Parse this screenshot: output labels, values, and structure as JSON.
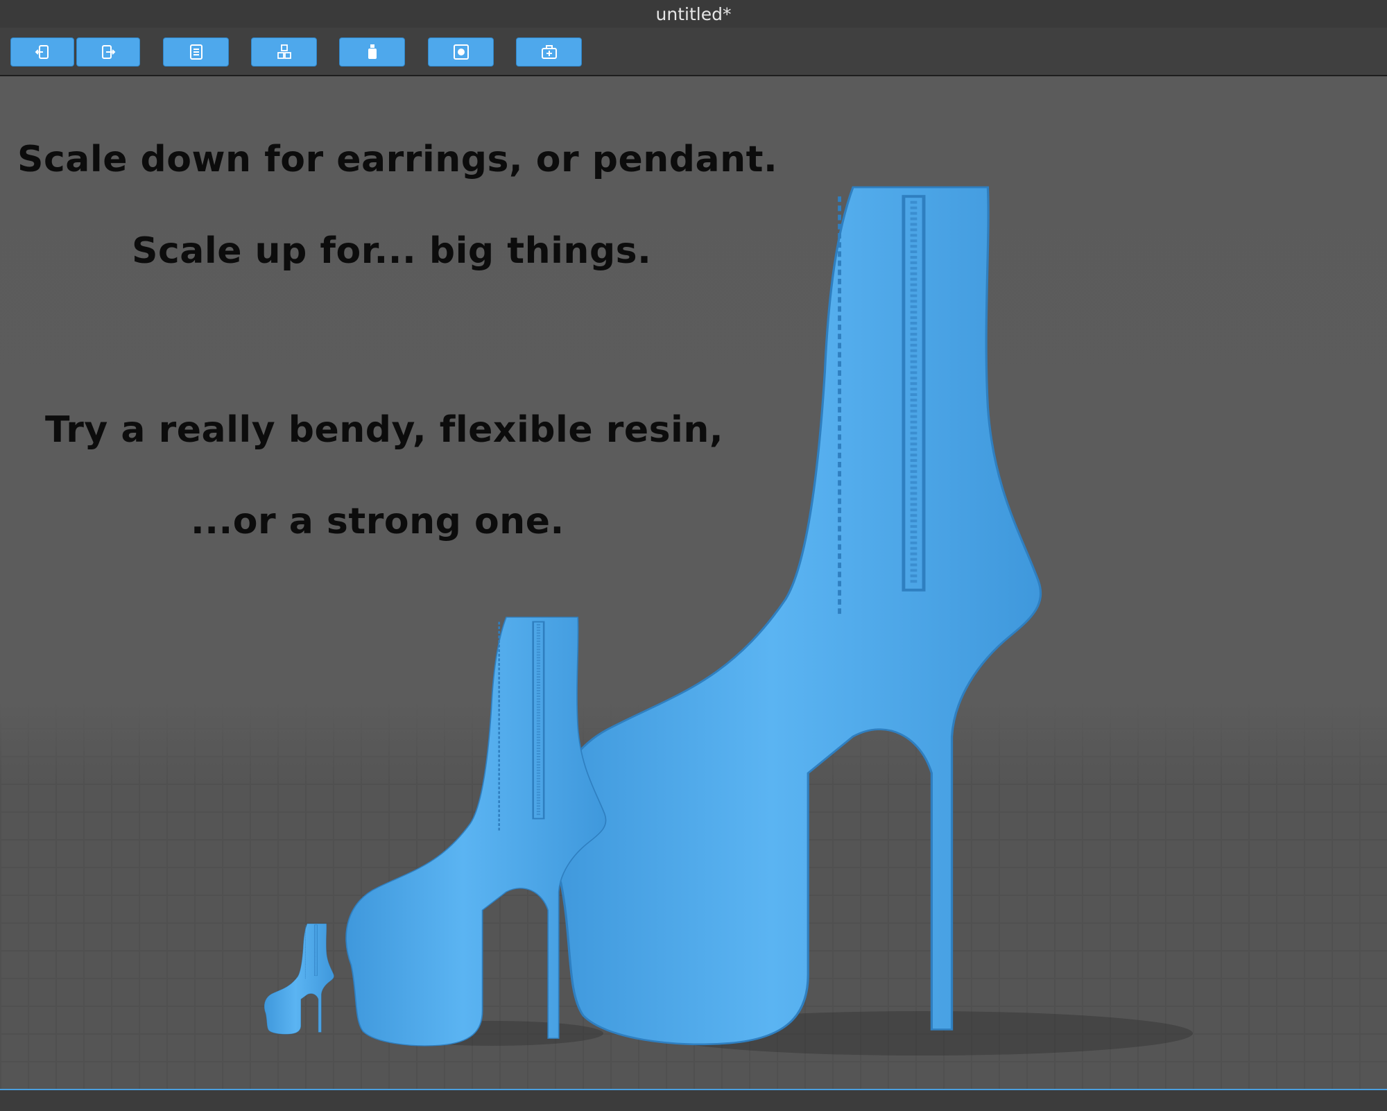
{
  "window": {
    "title": "untitled*"
  },
  "toolbar": {
    "buttons": [
      {
        "name": "import-icon"
      },
      {
        "name": "export-icon"
      },
      {
        "name": "list-icon"
      },
      {
        "name": "cubes-icon"
      },
      {
        "name": "bottle-icon"
      },
      {
        "name": "square-target-icon"
      },
      {
        "name": "add-support-icon"
      }
    ]
  },
  "viewport": {
    "lines": [
      "Scale down for earrings, or pendant.",
      "Scale up for... big things.",
      "Try a really bendy, flexible resin,",
      "...or a strong one."
    ],
    "model_color": "#4ea8ec"
  }
}
